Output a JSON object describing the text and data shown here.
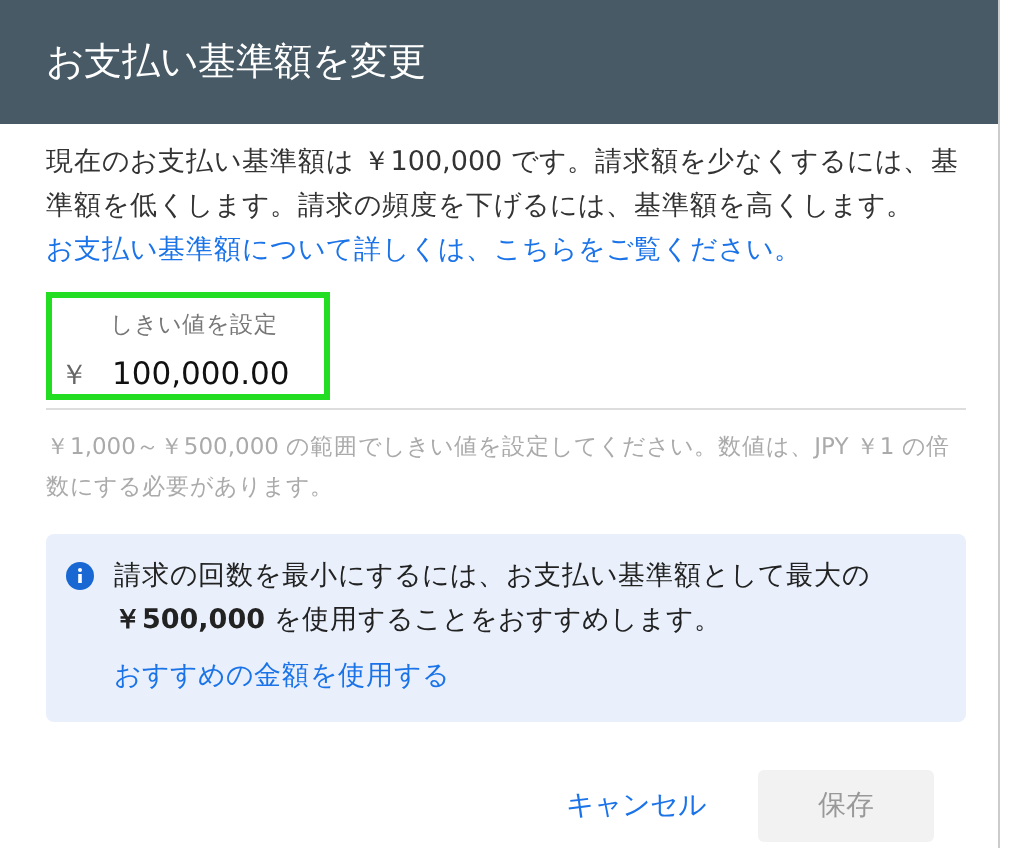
{
  "dialog": {
    "title": "お支払い基準額を変更",
    "description": "現在のお支払い基準額は ￥100,000 です。請求額を少なくするには、基準額を低くします。請求の頻度を下げるには、基準額を高くします。",
    "learn_more_link": "お支払い基準額について詳しくは、こちらをご覧ください。",
    "field": {
      "label": "しきい値を設定",
      "prefix": "￥",
      "value": "100,000.00",
      "highlighted": true
    },
    "helper_text": "￥1,000～￥500,000 の範囲でしきい値を設定してください。数値は、JPY ￥1 の倍数にする必要があります。",
    "recommendation": {
      "text": "請求の回数を最小にするには、お支払い基準額として最大の**￥500,000** を使用することをおすすめします。",
      "link": "おすすめの金額を使用する"
    },
    "buttons": [
      {
        "label": "キャンセル",
        "kind": "text",
        "disabled": false
      },
      {
        "label": "保存",
        "kind": "filled",
        "disabled": true
      }
    ]
  }
}
